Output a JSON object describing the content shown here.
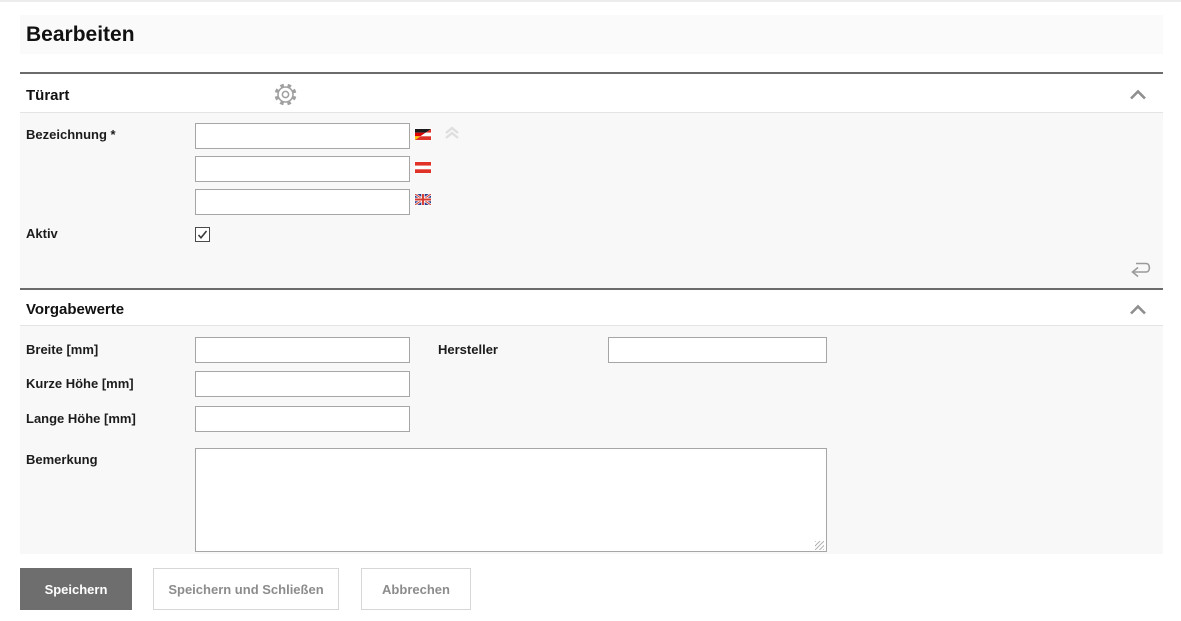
{
  "page": {
    "title": "Bearbeiten"
  },
  "colors": {
    "section_bg": "#f8f8f8",
    "titlebar_bg": "#fafafa",
    "rule_dark": "#6b6b6b",
    "rule_light": "#e4e4e4",
    "primary_button_bg": "#6e6e6e",
    "secondary_button_text": "#8c8c8c",
    "input_border": "#a6a6a6",
    "icon_gray": "#9a9a9a"
  },
  "icons": {
    "settings": "gear-icon",
    "collapse_section": "chevron-up-icon",
    "collapse_languages": "double-chevron-up-icon",
    "revert": "undo-arrow-icon",
    "flag_row1": "flag-germany-austria",
    "flag_row2": "flag-austria",
    "flag_row3": "flag-united-kingdom"
  },
  "tuerart": {
    "title": "Türart",
    "bezeichnung_label": "Bezeichnung *",
    "bezeichnung_values": [
      "",
      "",
      ""
    ],
    "aktiv_label": "Aktiv",
    "aktiv_checked": true
  },
  "vorgabewerte": {
    "title": "Vorgabewerte",
    "breite_label": "Breite [mm]",
    "breite_value": "",
    "kurze_hoehe_label": "Kurze Höhe [mm]",
    "kurze_hoehe_value": "",
    "lange_hoehe_label": "Lange Höhe [mm]",
    "lange_hoehe_value": "",
    "hersteller_label": "Hersteller",
    "hersteller_value": "",
    "bemerkung_label": "Bemerkung",
    "bemerkung_value": ""
  },
  "buttons": {
    "save": "Speichern",
    "save_and_close": "Speichern und Schließen",
    "cancel": "Abbrechen"
  }
}
